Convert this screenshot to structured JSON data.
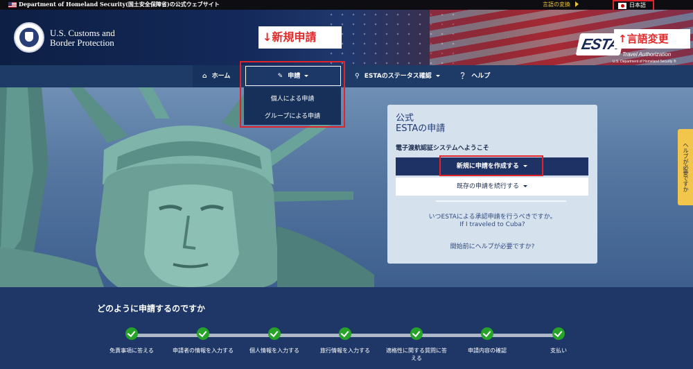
{
  "topbar": {
    "gov_text": "Department of Homeland Security(国土安全保障省)の公式ウェブサイト",
    "lang_change": "言語の変換",
    "lang_current": "日本語"
  },
  "header": {
    "agency_line1": "U.S. Customs and",
    "agency_line2": "Border Protection",
    "annotation_new": "↓新規申請",
    "annotation_lang": "↑言語変更",
    "esta_logo": "ESTA",
    "esta_sub": "Travel Authorization",
    "esta_sub_small": "U.S. Department of Homeland Security ®"
  },
  "nav": {
    "home": "ホーム",
    "apply": "申請",
    "status": "ESTAのステータス確認",
    "help": "ヘルプ"
  },
  "dropdown": {
    "individual": "個人による申請",
    "group": "グループによる申請"
  },
  "help_tab": "ヘルプが必要ですか",
  "card": {
    "title_line1": "公式",
    "title_line2": "ESTAの申請",
    "welcome": "電子渡航認証システムへようこそ",
    "new_button": "新規に申請を作成する",
    "continue_button": "既存の申請を続行する",
    "when_link": "いつESTAによる承認申請を行うべきですか。",
    "cuba_link": "If I traveled to Cuba?",
    "help_link": "開始前にヘルプが必要ですか?"
  },
  "steps": {
    "title": "どのように申請するのですか",
    "items": [
      "免責事項に答える",
      "申請者の情報を入力する",
      "個人情報を入力する",
      "旅行情報を入力する",
      "適格性に関する質問に答える",
      "申請内容の確認",
      "支払い"
    ]
  },
  "icons": {
    "home": "home-icon",
    "pencil": "pencil-icon",
    "search": "search-icon",
    "help": "question-circle-icon"
  }
}
